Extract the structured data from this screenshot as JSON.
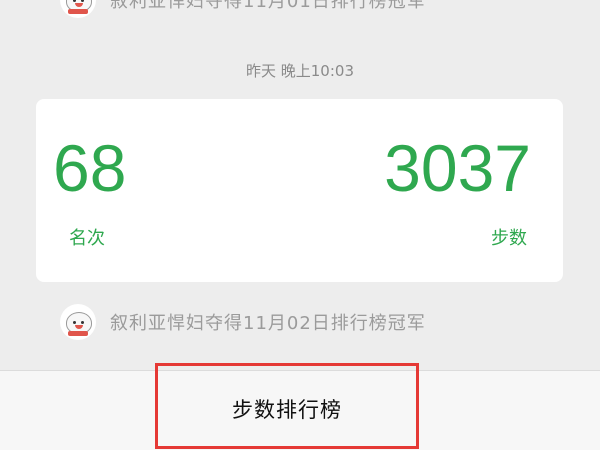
{
  "notifications": [
    {
      "text": "叙利亚悍妇夺得11月01日排行榜冠军"
    },
    {
      "text": "叙利亚悍妇夺得11月02日排行榜冠军"
    }
  ],
  "timestamp": "昨天 晚上10:03",
  "card": {
    "rank_value": "68",
    "rank_label": "名次",
    "steps_value": "3037",
    "steps_label": "步数"
  },
  "bottom_bar": {
    "leaderboard_label": "步数排行榜"
  },
  "colors": {
    "accent_green": "#2fa84f",
    "highlight_red": "#e53935"
  },
  "icons": {
    "avatar": "snowman-avatar-icon"
  }
}
